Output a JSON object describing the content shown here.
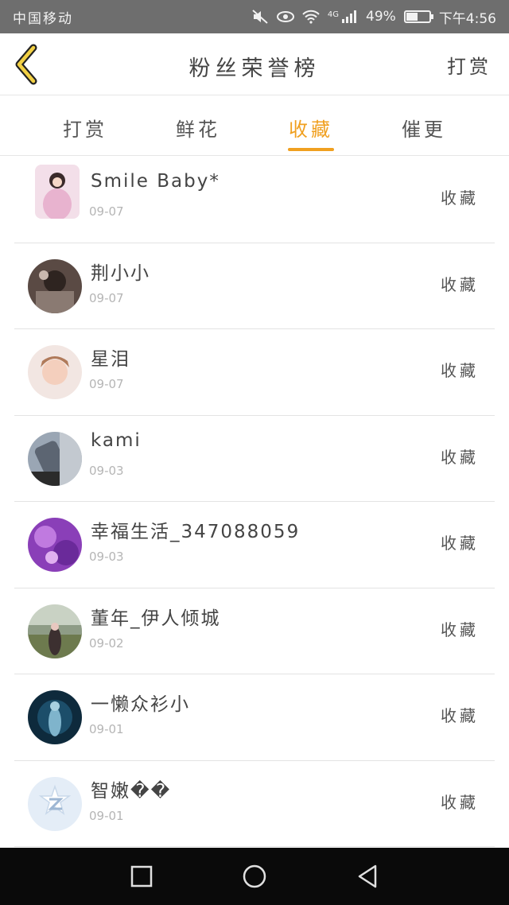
{
  "status_bar": {
    "carrier": "中国移动",
    "network": "4G",
    "battery": "49%",
    "battery_level": 0.49,
    "time": "下午4:56",
    "icons": [
      "mute-icon",
      "eye-icon",
      "wifi-icon",
      "signal-icon",
      "battery-icon"
    ]
  },
  "header": {
    "title": "粉丝荣誉榜",
    "right_action": "打赏",
    "back_icon": "chevron-left-icon"
  },
  "colors": {
    "accent": "#f0a020",
    "status_bar": "#6e6e6e",
    "nav_bar": "#0a0a0a"
  },
  "tabs": [
    {
      "label": "打赏",
      "active": false
    },
    {
      "label": "鲜花",
      "active": false
    },
    {
      "label": "收藏",
      "active": true
    },
    {
      "label": "催更",
      "active": false
    }
  ],
  "fans": [
    {
      "name": "Smile Baby*",
      "date": "09-07",
      "action": "收藏"
    },
    {
      "name": "荆小小",
      "date": "09-07",
      "action": "收藏"
    },
    {
      "name": "星泪",
      "date": "09-07",
      "action": "收藏"
    },
    {
      "name": "kami",
      "date": "09-03",
      "action": "收藏"
    },
    {
      "name": "幸福生活_347088059",
      "date": "09-03",
      "action": "收藏"
    },
    {
      "name": "董年_伊人倾城",
      "date": "09-02",
      "action": "收藏"
    },
    {
      "name": "一懒众衫小",
      "date": "09-01",
      "action": "收藏"
    },
    {
      "name": "智嫩��",
      "date": "09-01",
      "action": "收藏"
    }
  ],
  "nav_bar": {
    "icons": [
      "recent-apps-icon",
      "home-icon",
      "back-icon"
    ]
  }
}
